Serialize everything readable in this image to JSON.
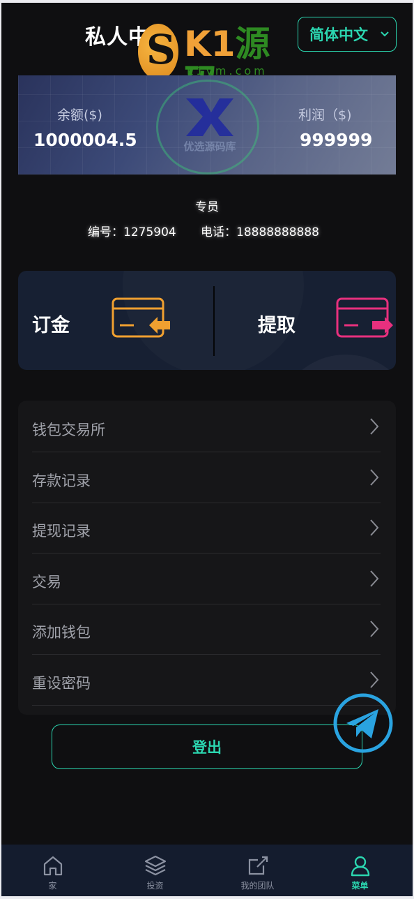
{
  "header": {
    "title": "私人中心",
    "language": "简体中文"
  },
  "watermark": {
    "brand": "K1",
    "brand_cn": "源码",
    "domain": "k1ym.com"
  },
  "banner": {
    "badge_text": "优选源码库",
    "balance_label": "余额($)",
    "balance_value": "1000004.5",
    "profit_label": "利润（$)",
    "profit_value": "999999"
  },
  "agent": {
    "role": "专员",
    "id_label": "编号：",
    "id_value": "1275904",
    "phone_label": "电话：",
    "phone_value": "18888888888"
  },
  "actions": {
    "deposit": "订金",
    "withdraw": "提取"
  },
  "menu": {
    "items": [
      {
        "label": "钱包交易所"
      },
      {
        "label": "存款记录"
      },
      {
        "label": "提现记录"
      },
      {
        "label": "交易"
      },
      {
        "label": "添加钱包"
      },
      {
        "label": "重设密码"
      }
    ]
  },
  "logout": "登出",
  "nav": {
    "items": [
      {
        "label": "家",
        "icon": "home-icon"
      },
      {
        "label": "投资",
        "icon": "layers-icon"
      },
      {
        "label": "我的团队",
        "icon": "share-icon"
      },
      {
        "label": "菜单",
        "icon": "user-icon"
      }
    ]
  },
  "colors": {
    "accent": "#2bd6b0",
    "deposit": "#f0a030",
    "withdraw": "#e8307e"
  }
}
